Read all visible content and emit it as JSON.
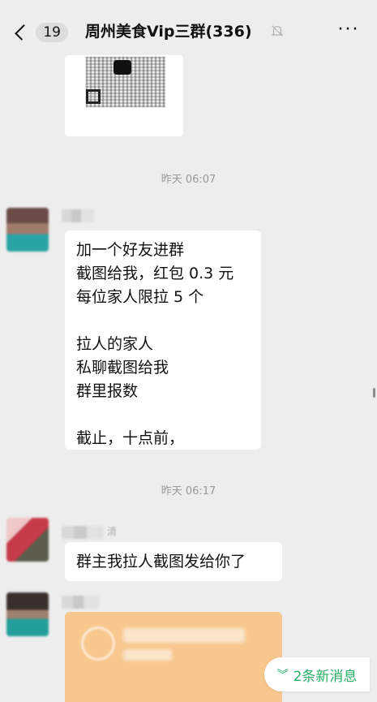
{
  "header": {
    "unread_count": "19",
    "title": "周州美食Vip三群(336)",
    "more_label": "···"
  },
  "icons": {
    "back": "chevron-left-icon",
    "mute": "bell-off-icon",
    "more": "more-icon",
    "new_messages": "double-chevron-down-icon"
  },
  "messages": [
    {
      "time": "昨天 06:07"
    },
    {
      "text": "加一个好友进群\n截图给我，红包 0.3 元\n每位家人限拉 5 个\n\n拉人的家人\n私聊截图给我\n群里报数\n\n截止，十点前，",
      "nick_suffix": ""
    },
    {
      "time": "昨天 06:17"
    },
    {
      "nick_suffix": "清",
      "text": "群主我拉人截图发给你了"
    }
  ],
  "new_messages": {
    "label": "2条新消息"
  },
  "colors": {
    "background": "#ededed",
    "bubble": "#ffffff",
    "accent_green": "#2aae67",
    "timestamp": "#999999",
    "card_orange": "#f7c78e"
  }
}
